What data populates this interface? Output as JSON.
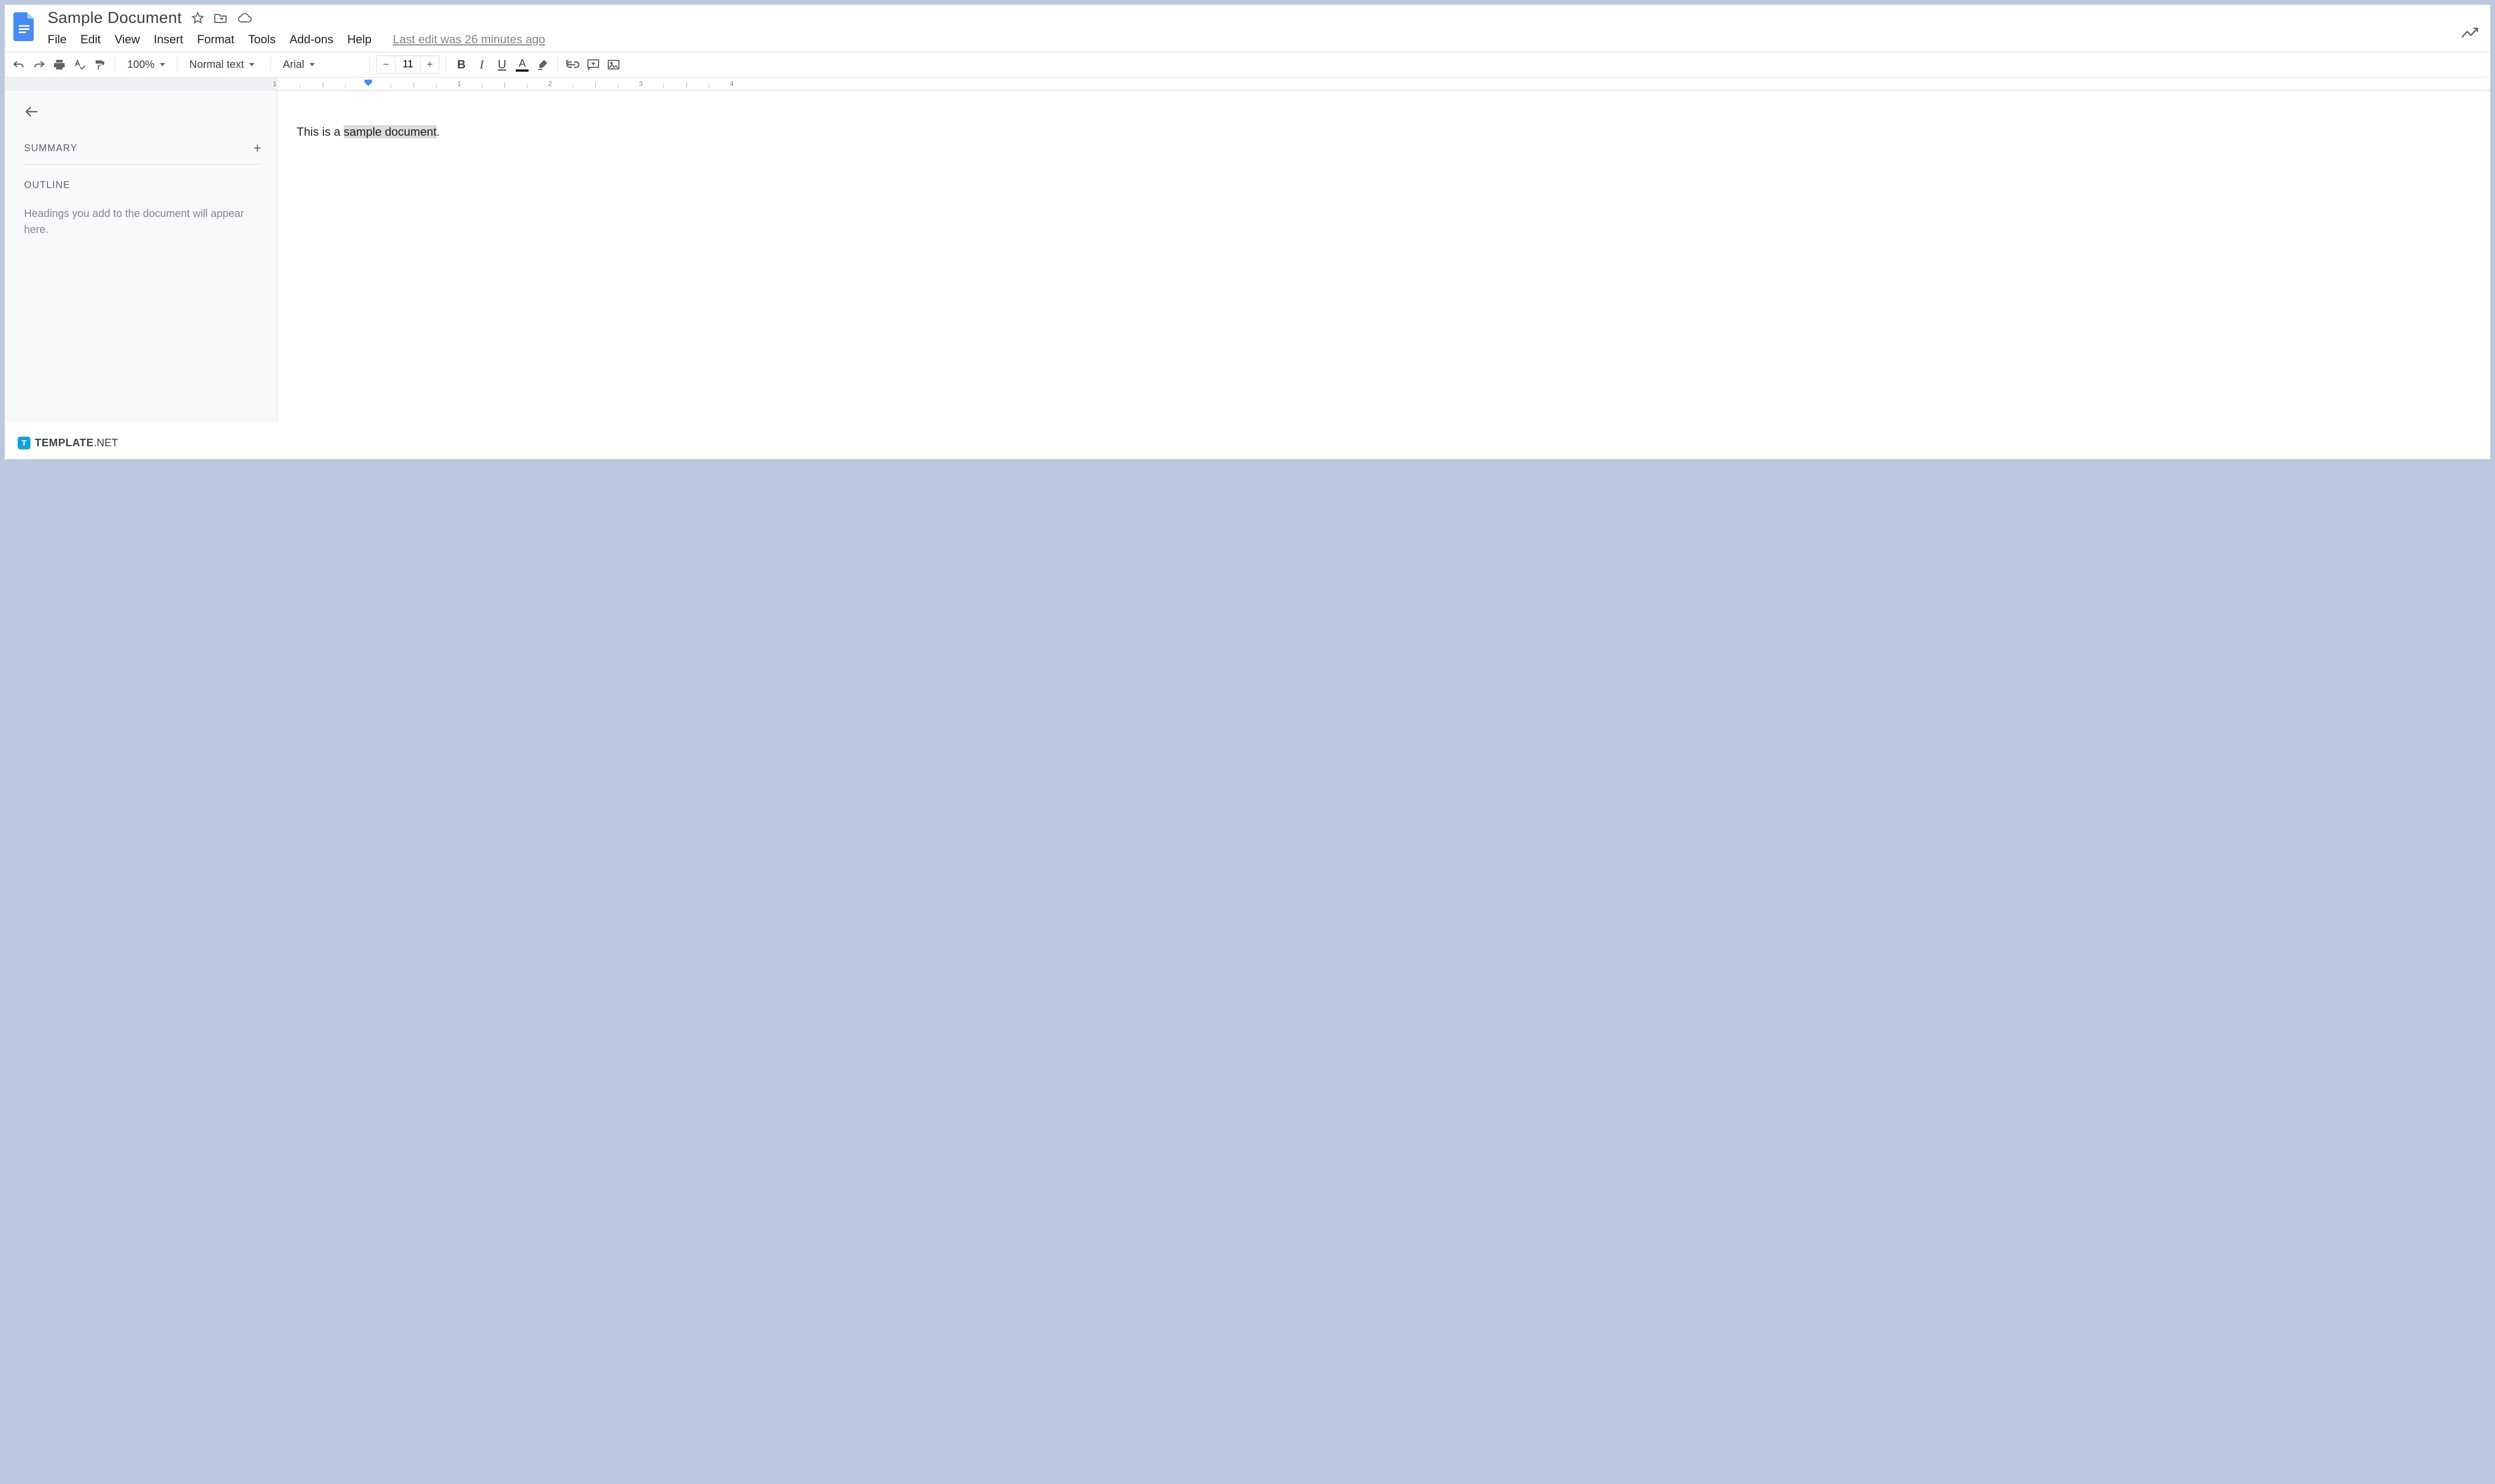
{
  "header": {
    "doc_title": "Sample Document",
    "last_edit": "Last edit was 26 minutes ago"
  },
  "menubar": {
    "file": "File",
    "edit": "Edit",
    "view": "View",
    "insert": "Insert",
    "format": "Format",
    "tools": "Tools",
    "addons": "Add-ons",
    "help": "Help"
  },
  "toolbar": {
    "zoom": "100%",
    "style": "Normal text",
    "font": "Arial",
    "font_size": "11"
  },
  "ruler": {
    "n1": "1",
    "n2": "1",
    "n3": "2",
    "n4": "3",
    "n5": "4"
  },
  "sidebar": {
    "summary_label": "SUMMARY",
    "outline_label": "OUTLINE",
    "outline_hint": "Headings you add to the document will appear here."
  },
  "document": {
    "text_prefix": "This is a ",
    "text_highlight": "sample document",
    "text_suffix": "."
  },
  "watermark": {
    "badge": "T",
    "brand": "TEMPLATE",
    "tld": ".NET"
  }
}
